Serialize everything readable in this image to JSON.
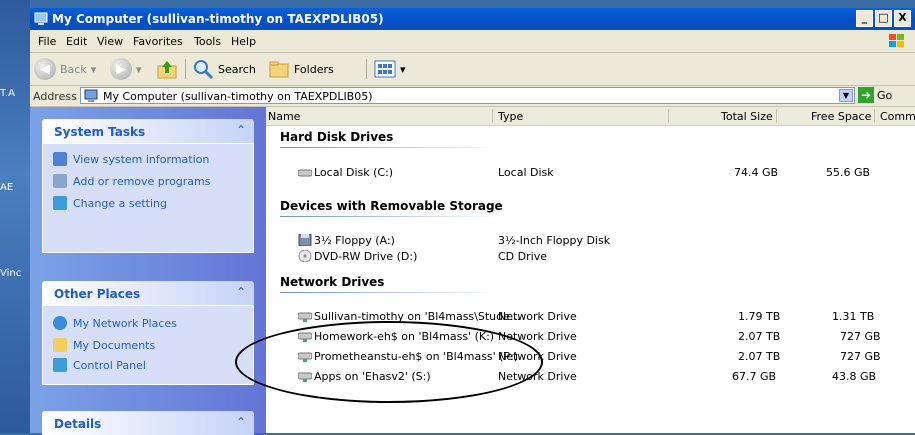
{
  "window": {
    "title": "My Computer (sullivan-timothy on TAEXPDLIB05)",
    "controls": [
      "_",
      "□",
      "X"
    ]
  },
  "desktop": {
    "labels": [
      "T.A",
      "AE",
      "Vinc"
    ]
  },
  "menu": [
    "File",
    "Edit",
    "View",
    "Favorites",
    "Tools",
    "Help"
  ],
  "toolbar": {
    "back": "Back",
    "search": "Search",
    "folders": "Folders"
  },
  "address": {
    "label": "Address",
    "value": "My Computer (sullivan-timothy on TAEXPDLIB05)",
    "go": "Go"
  },
  "task_panels": [
    {
      "title": "System Tasks",
      "items": [
        "View system information",
        "Add or remove programs",
        "Change a setting"
      ]
    },
    {
      "title": "Other Places",
      "items": [
        "My Network Places",
        "My Documents",
        "Control Panel"
      ]
    },
    {
      "title": "Details",
      "items": []
    }
  ],
  "columns": [
    "Name",
    "Type",
    "Total Size",
    "Free Space",
    "Comm"
  ],
  "groups": [
    {
      "title": "Hard Disk Drives",
      "rows": [
        {
          "name": "Local Disk (C:)",
          "type": "Local Disk",
          "total": "74.4 GB",
          "free": "55.6 GB",
          "icon": "hard-disk-icon"
        }
      ]
    },
    {
      "title": "Devices with Removable Storage",
      "rows": [
        {
          "name": "3½ Floppy (A:)",
          "type": "3½-Inch Floppy Disk",
          "total": "",
          "free": "",
          "icon": "floppy-icon"
        },
        {
          "name": "DVD-RW Drive (D:)",
          "type": "CD Drive",
          "total": "",
          "free": "",
          "icon": "dvd-icon"
        }
      ]
    },
    {
      "title": "Network Drives",
      "rows": [
        {
          "name": "Sullivan-timothy on 'Bl4mass\\Stude...",
          "type": "Network Drive",
          "total": "1.79 TB",
          "free": "1.31 TB",
          "icon": "network-drive-icon"
        },
        {
          "name": "Homework-eh$ on 'Bl4mass' (K:)",
          "type": "Network Drive",
          "total": "2.07 TB",
          "free": "727 GB",
          "icon": "network-drive-icon"
        },
        {
          "name": "Prometheanstu-eh$ on 'Bl4mass' (P:)",
          "type": "Network Drive",
          "total": "2.07 TB",
          "free": "727 GB",
          "icon": "network-drive-icon"
        },
        {
          "name": "Apps on 'Ehasv2' (S:)",
          "type": "Network Drive",
          "total": "67.7 GB",
          "free": "43.8 GB",
          "icon": "network-drive-icon"
        }
      ]
    }
  ],
  "colors": {
    "title_blue": "#0450c8",
    "task_link": "#215dc6",
    "chrome": "#ece9d8"
  }
}
